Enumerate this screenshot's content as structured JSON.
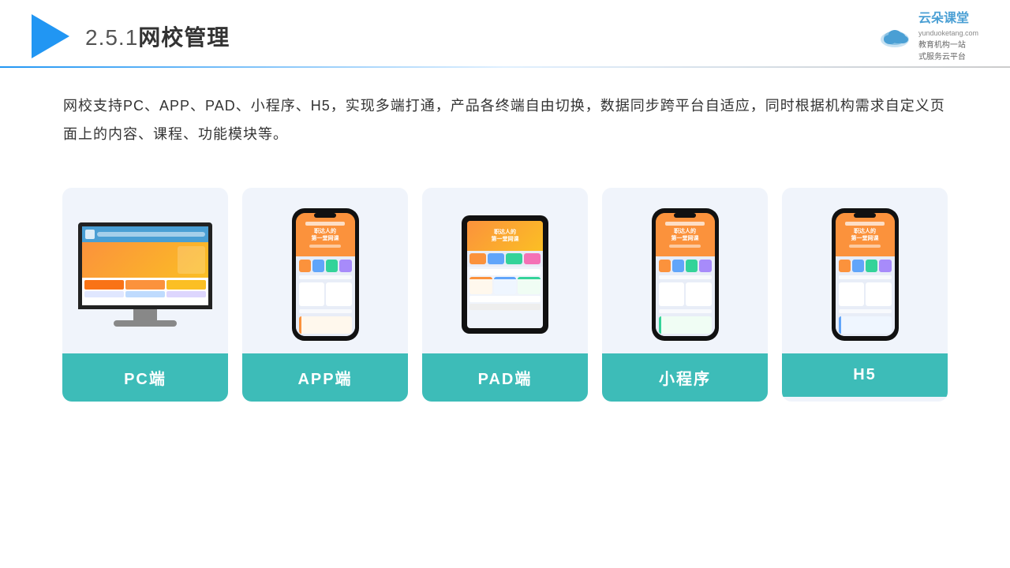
{
  "header": {
    "title": "2.5.1网校管理",
    "title_num": "2.5.1",
    "title_cn": "网校管理"
  },
  "brand": {
    "name": "云朵课堂",
    "url": "yunduoketang.com",
    "tagline": "教育机构一站\n式服务云平台"
  },
  "description": {
    "text": "网校支持PC、APP、PAD、小程序、H5，实现多端打通，产品各终端自由切换，数据同步跨平台自适应，同时根据机构需求自定义页面上的内容、课程、功能模块等。"
  },
  "cards": [
    {
      "id": "pc",
      "label": "PC端",
      "type": "pc"
    },
    {
      "id": "app",
      "label": "APP端",
      "type": "phone"
    },
    {
      "id": "pad",
      "label": "PAD端",
      "type": "tablet"
    },
    {
      "id": "miniprogram",
      "label": "小程序",
      "type": "phone"
    },
    {
      "id": "h5",
      "label": "H5",
      "type": "phone"
    }
  ],
  "colors": {
    "primary_blue": "#2196F3",
    "teal": "#3dbcb8",
    "orange": "#fb923c",
    "card_bg": "#f0f4fb"
  }
}
